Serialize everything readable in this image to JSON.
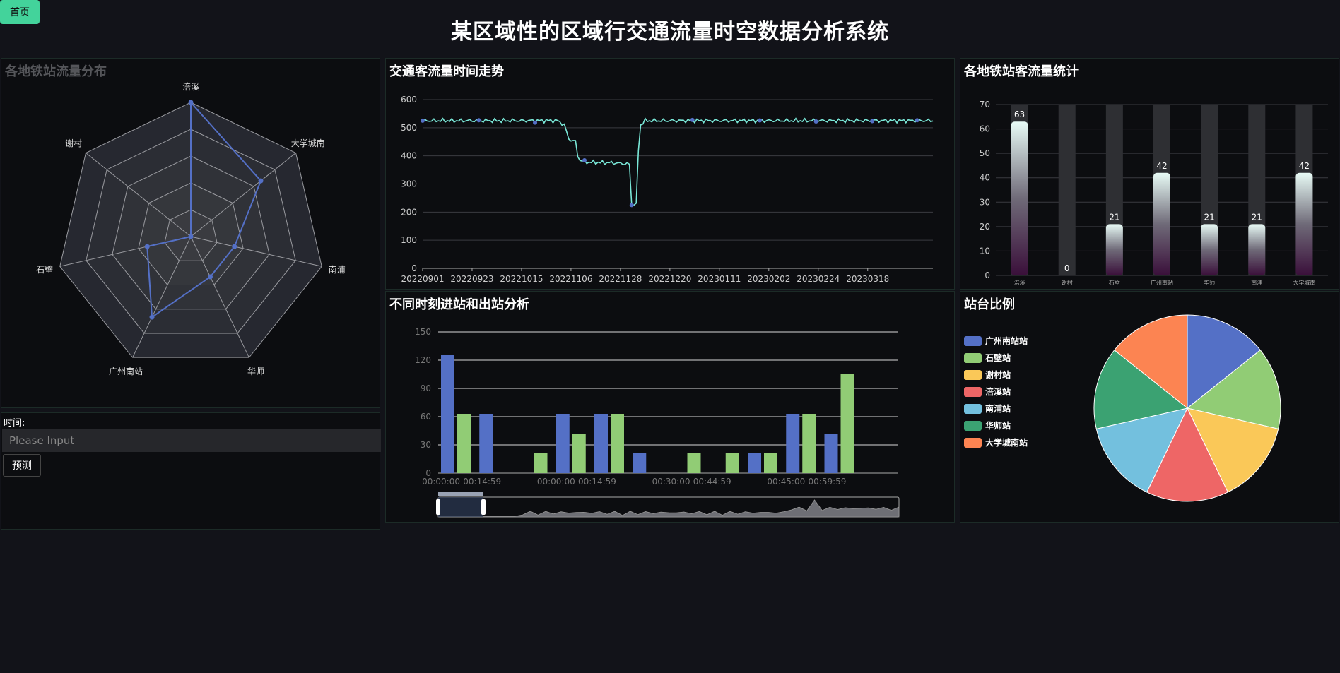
{
  "nav": {
    "home_label": "首页"
  },
  "page_title": "某区域性的区域行交通流量时空数据分析系统",
  "radar_panel": {
    "title": "各地铁站流量分布"
  },
  "form": {
    "time_label": "时间:",
    "placeholder": "Please Input",
    "predict_label": "预测"
  },
  "line_panel": {
    "title": "交通客流量时间走势"
  },
  "bar_panel": {
    "title": "各地铁站客流量统计"
  },
  "group_panel": {
    "title": "不同时刻进站和出站分析"
  },
  "pie_panel": {
    "title": "站台比例"
  },
  "colors": {
    "accent": "#43d39b",
    "blue": "#5470c6",
    "green": "#91cc75",
    "yellow": "#fac858",
    "red": "#ee6666",
    "cyan": "#73c0de",
    "teal": "#3ba272",
    "orange": "#fc8452",
    "line": "#7ae8d8"
  },
  "chart_data": [
    {
      "id": "radar",
      "type": "radar",
      "indicators": [
        "涪溪",
        "大学城南",
        "南浦",
        "华师",
        "广州南站",
        "石壁",
        "谢村"
      ],
      "values": [
        63,
        42,
        21,
        21,
        42,
        21,
        0
      ],
      "max": 63
    },
    {
      "id": "line",
      "type": "line",
      "x_ticks": [
        "20220901",
        "20220923",
        "20221015",
        "20221106",
        "20221128",
        "20221220",
        "20230111",
        "20230202",
        "20230224",
        "20230318"
      ],
      "ylim": [
        0,
        600
      ],
      "y_ticks": [
        0,
        100,
        200,
        300,
        400,
        500,
        600
      ],
      "x_end": 227,
      "x_step": 22,
      "keyframes": [
        [
          0,
          525
        ],
        [
          60,
          525
        ],
        [
          63,
          510
        ],
        [
          65,
          460
        ],
        [
          68,
          450
        ],
        [
          69,
          400
        ],
        [
          70,
          385
        ],
        [
          72,
          378
        ],
        [
          85,
          375
        ],
        [
          90,
          372
        ],
        [
          92,
          370
        ],
        [
          93,
          225
        ],
        [
          95,
          225
        ],
        [
          96,
          420
        ],
        [
          97,
          510
        ],
        [
          99,
          525
        ],
        [
          227,
          525
        ]
      ],
      "markers": [
        0,
        25,
        50,
        72,
        93,
        120,
        150,
        175,
        200,
        220
      ]
    },
    {
      "id": "station_bar",
      "type": "bar",
      "categories": [
        "涪溪",
        "谢村",
        "石壁",
        "广州南站",
        "华师",
        "南浦",
        "大学城南"
      ],
      "values": [
        63,
        0,
        21,
        42,
        21,
        21,
        42
      ],
      "ylim": [
        0,
        70
      ],
      "y_ticks": [
        0,
        10,
        20,
        30,
        40,
        50,
        60,
        70
      ]
    },
    {
      "id": "inout_bar",
      "type": "bar",
      "categories": [
        "00:00:00-00:14:59",
        "",
        "",
        "00:00:00-00:14:59",
        "",
        "",
        "00:30:00-00:44:59",
        "",
        "",
        "00:45:00-00:59:59",
        "",
        ""
      ],
      "x_tick_labels": [
        "00:00:00-00:14:59",
        "00:00:00-00:14:59",
        "00:30:00-00:44:59",
        "00:45:00-00:59:59"
      ],
      "series": [
        {
          "values": [
            126,
            63,
            0,
            63,
            63,
            21,
            0,
            0,
            21,
            63,
            42,
            0
          ]
        },
        {
          "values": [
            63,
            0,
            21,
            42,
            63,
            0,
            21,
            21,
            21,
            63,
            105,
            0
          ]
        }
      ],
      "ylim": [
        0,
        150
      ],
      "y_ticks": [
        0,
        30,
        60,
        90,
        120,
        150
      ]
    },
    {
      "id": "pie",
      "type": "pie",
      "labels": [
        "广州南站站",
        "石壁站",
        "谢村站",
        "涪溪站",
        "南浦站",
        "华师站",
        "大学城南站"
      ],
      "values": [
        1,
        1,
        1,
        1,
        1,
        1,
        1
      ]
    }
  ]
}
